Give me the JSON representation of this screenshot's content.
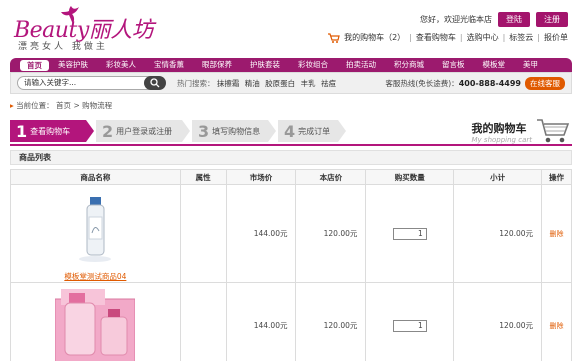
{
  "header": {
    "logo_text": "Beauty丽人坊",
    "logo_sub": "漂亮女人 我做主",
    "greeting": "您好，欢迎光临本店",
    "login_label": "登陆",
    "register_label": "注册",
    "cart_link": "我的购物车（2）",
    "links": [
      "查看购物车",
      "选购中心",
      "标签云",
      "报价单"
    ]
  },
  "nav": {
    "items": [
      "首页",
      "美容护肤",
      "彩妆美人",
      "宝情香薰",
      "眼部保养",
      "护肤套装",
      "彩妆组合",
      "拍卖活动",
      "积分商城",
      "留言板",
      "模板堂",
      "美甲"
    ]
  },
  "search": {
    "placeholder": "请输入关键字...",
    "hot_label": "热门搜索：",
    "hot_words": [
      "抹擦霜",
      "精油",
      "胶原蛋白",
      "丰乳",
      "祛痘"
    ],
    "hotline_label": "客服热线(免长途费)：",
    "hotline": "400-888-4499",
    "online_label": "在线客服"
  },
  "breadcrumb": {
    "prefix": "当前位置：",
    "home": "首页",
    "sep": ">",
    "current": "购物流程"
  },
  "steps": [
    {
      "num": "1",
      "label": "查看购物车"
    },
    {
      "num": "2",
      "label": "用户登录或注册"
    },
    {
      "num": "3",
      "label": "填写购物信息"
    },
    {
      "num": "4",
      "label": "完成订单"
    }
  ],
  "mycart": {
    "title": "我的购物车",
    "subtitle": "My shopping cart"
  },
  "list": {
    "title": "商品列表",
    "columns": [
      "商品名称",
      "属性",
      "市场价",
      "本店价",
      "购买数量",
      "小计",
      "操作"
    ],
    "rows": [
      {
        "name": "模板堂测试商品04",
        "attr": "",
        "market": "144.00元",
        "price": "120.00元",
        "qty": "1",
        "subtotal": "120.00元",
        "op": "删除"
      },
      {
        "name": "",
        "attr": "",
        "market": "144.00元",
        "price": "120.00元",
        "qty": "1",
        "subtotal": "120.00元",
        "op": "删除"
      }
    ]
  },
  "colors": {
    "brand": "#b3157c",
    "nav": "#9c1a6e",
    "accent": "#e05a00"
  }
}
